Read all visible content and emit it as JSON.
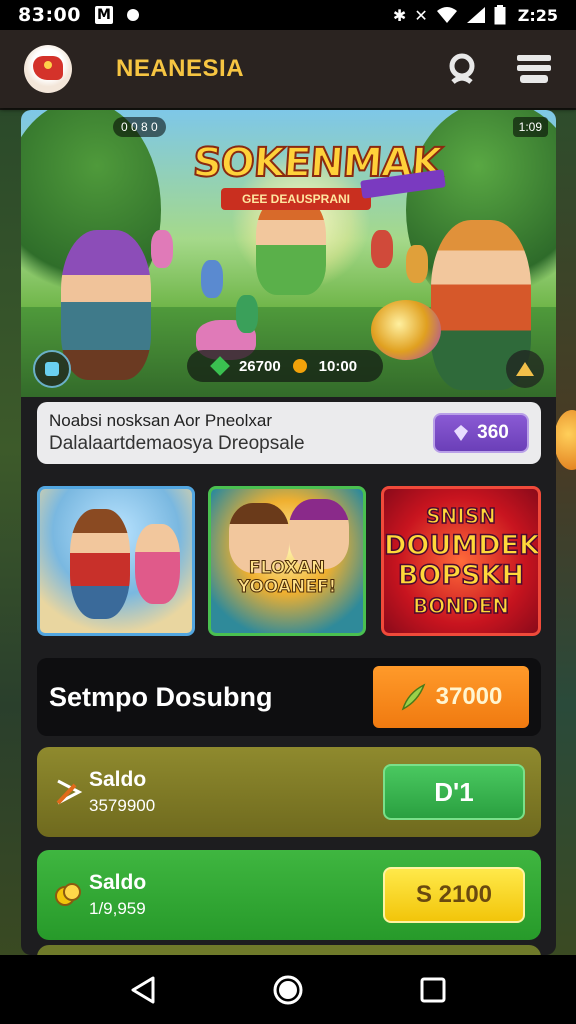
{
  "status_bar": {
    "time": "83:00",
    "notification_letter": "M",
    "clock": "Z:25"
  },
  "app_bar": {
    "brand": "NEANESIA"
  },
  "hero": {
    "title": "SOKENMAK",
    "subtitle": "GEE DEAUSPRANI",
    "chip_left": "0 0 8 0",
    "chip_right": "1:09",
    "gems": "26700",
    "coins": "10:00"
  },
  "notice": {
    "line1": "Noabsi nosksan Aor Pneolxar",
    "line2": "Dalalaartdemaosya Dreopsale",
    "price": "360"
  },
  "tiles": {
    "middle_text": "FLOXAN YOOANEF!",
    "right_text_lines": [
      "SNISN",
      "DOUMDEK",
      "BOPSKH",
      "BONDEN"
    ]
  },
  "promo": {
    "title": "Setmpo Dosubng",
    "amount": "37000"
  },
  "balances": [
    {
      "label": "Saldo",
      "value": "3579900",
      "action": "D'1"
    },
    {
      "label": "Saldo",
      "value": "1/9,959",
      "action": "S 2100"
    }
  ],
  "colors": {
    "brand": "#f6c542",
    "price_button": "#7a4ac8",
    "promo_button": "#f5861a",
    "balance1_bg": "#8a8528",
    "balance2_bg": "#35aa36",
    "yellow_button": "#f5d21a"
  }
}
